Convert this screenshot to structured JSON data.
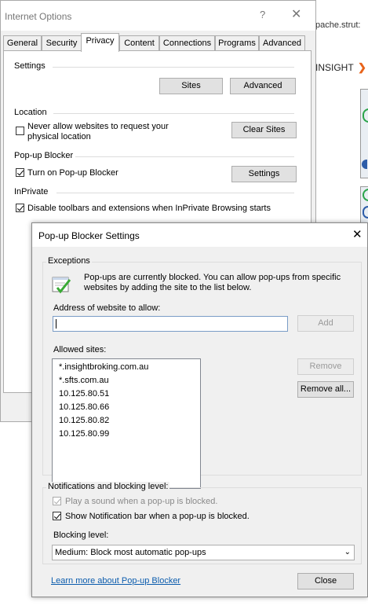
{
  "background_browser": {
    "url_fragment": "pache.strut:",
    "brand_text": "INSIGHT"
  },
  "internet_options": {
    "title": "Internet Options",
    "help_glyph": "?",
    "close_glyph": "✕",
    "tabs": [
      "General",
      "Security",
      "Privacy",
      "Content",
      "Connections",
      "Programs",
      "Advanced"
    ],
    "active_tab": "Privacy",
    "settings": {
      "heading": "Settings",
      "sites_button": "Sites",
      "advanced_button": "Advanced"
    },
    "location": {
      "heading": "Location",
      "checkbox_label_line1": "Never allow websites to request your",
      "checkbox_label_line2": "physical location",
      "checked": false,
      "clear_sites_button": "Clear Sites"
    },
    "popup_blocker": {
      "heading": "Pop-up Blocker",
      "checkbox_label": "Turn on Pop-up Blocker",
      "checked": true,
      "settings_button": "Settings"
    },
    "inprivate": {
      "heading": "InPrivate",
      "checkbox_label": "Disable toolbars and extensions when InPrivate Browsing starts",
      "checked": true
    }
  },
  "popup_settings": {
    "title": "Pop-up Blocker Settings",
    "close_glyph": "✕",
    "exceptions": {
      "group_label": "Exceptions",
      "info_line1": "Pop-ups are currently blocked.  You can allow pop-ups from specific",
      "info_line2": "websites by adding the site to the list below.",
      "address_label": "Address of website to allow:",
      "address_value": "",
      "add_button": "Add",
      "allowed_label": "Allowed sites:",
      "allowed_sites": [
        "*.insightbroking.com.au",
        "*.sfts.com.au",
        "10.125.80.51",
        "10.125.80.66",
        "10.125.80.82",
        "10.125.80.99"
      ],
      "remove_button": "Remove",
      "remove_all_button": "Remove all..."
    },
    "notifications": {
      "group_label": "Notifications and blocking level:",
      "play_sound_label": "Play a sound when a pop-up is blocked.",
      "play_sound_checked": true,
      "show_bar_label": "Show Notification bar when a pop-up is blocked.",
      "show_bar_checked": true,
      "blocking_level_label": "Blocking level:",
      "blocking_level_value": "Medium: Block most automatic pop-ups"
    },
    "learn_more_link": "Learn more about Pop-up Blocker",
    "close_button": "Close"
  }
}
